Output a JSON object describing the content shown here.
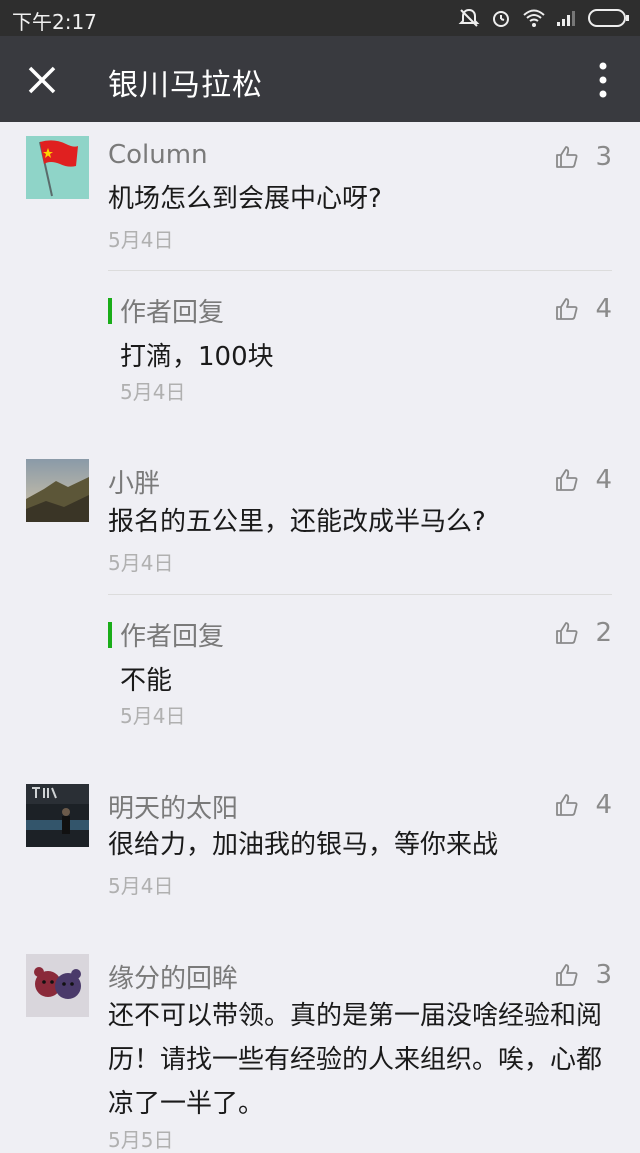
{
  "status": {
    "time": "下午2:17"
  },
  "header": {
    "title": "银川马拉松"
  },
  "comments": [
    {
      "name": "Column",
      "text": "机场怎么到会展中心呀?",
      "date": "5月4日",
      "likes": "3",
      "reply": {
        "label": "作者回复",
        "text": "打滴，100块",
        "date": "5月4日",
        "likes": "4"
      }
    },
    {
      "name": "小胖",
      "text": "报名的五公里，还能改成半马么?",
      "date": "5月4日",
      "likes": "4",
      "reply": {
        "label": "作者回复",
        "text": "不能",
        "date": "5月4日",
        "likes": "2"
      }
    },
    {
      "name": "明天的太阳",
      "text": "很给力，加油我的银马，等你来战",
      "date": "5月4日",
      "likes": "4"
    },
    {
      "name": "缘分的回眸",
      "text": "还不可以带领。真的是第一届没啥经验和阅历！请找一些有经验的人来组织。唉，心都凉了一半了。",
      "date": "5月5日",
      "likes": "3"
    }
  ],
  "colors": {
    "accent": "#1aad19",
    "titlebar": "#393a3f",
    "statusbar": "#2e2e2e"
  }
}
